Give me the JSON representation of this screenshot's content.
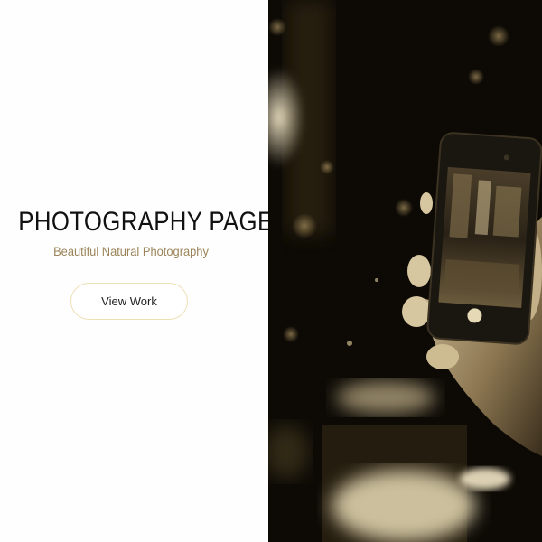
{
  "hero": {
    "title": "PHOTOGRAPHY PAGE",
    "subtitle": "Beautiful Natural Photography",
    "button_label": "View Work"
  },
  "photo": {
    "icon": "hand-holding-phone-photo",
    "tone": "sepia",
    "colors": {
      "dark": "#0d0a05",
      "mid": "#5a4a30",
      "light": "#efe3c3"
    }
  },
  "colors": {
    "subtitle": "#9a8458",
    "button_border": "#ece0b5",
    "title": "#111111"
  }
}
